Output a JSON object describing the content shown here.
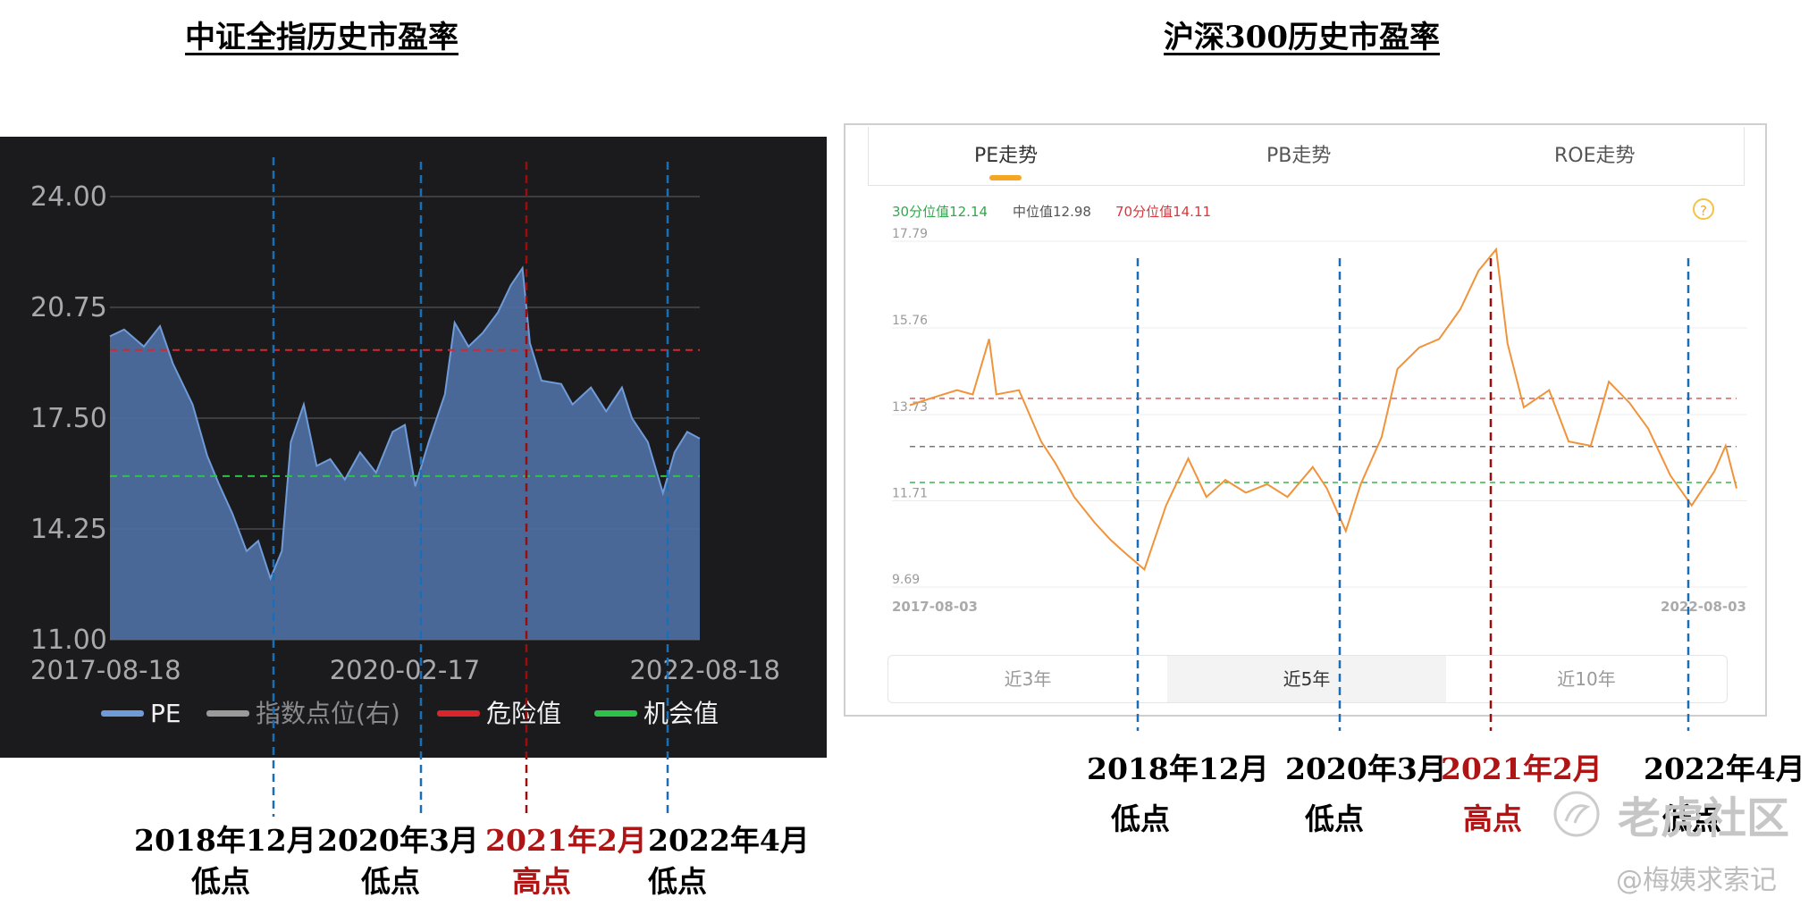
{
  "titles": {
    "left": "中证全指历史市盈率",
    "right": "沪深300历史市盈率"
  },
  "left_chart": {
    "y_ticks": [
      "24.00",
      "20.75",
      "17.50",
      "14.25",
      "11.00"
    ],
    "x_ticks": [
      "2017-08-18",
      "2020-02-17",
      "2022-08-18"
    ],
    "legend": [
      "PE",
      "指数点位(右)",
      "危险值",
      "机会值"
    ]
  },
  "right_chart": {
    "tabs": [
      "PE走势",
      "PB走势",
      "ROE走势"
    ],
    "stats": {
      "p30": "30分位值12.14",
      "median": "中位值12.98",
      "p70": "70分位值14.11"
    },
    "help": "?",
    "y_ticks": [
      "17.79",
      "15.76",
      "13.73",
      "11.71",
      "9.69"
    ],
    "x_start": "2017-08-03",
    "x_end": "2022-08-03",
    "range_buttons": [
      "近3年",
      "近5年",
      "近10年"
    ]
  },
  "left_annotations": [
    {
      "date": "2018年12月",
      "label": "低点"
    },
    {
      "date": "2020年3月",
      "label": "低点"
    },
    {
      "date": "2021年2月",
      "label": "高点"
    },
    {
      "date": "2022年4月",
      "label": "低点"
    }
  ],
  "right_annotations": [
    {
      "date": "2018年12月",
      "label": "低点"
    },
    {
      "date": "2020年3月",
      "label": "低点"
    },
    {
      "date": "2021年2月",
      "label": "高点"
    },
    {
      "date": "2022年4月",
      "label": "低点"
    }
  ],
  "watermarks": {
    "logo": "老虎社区",
    "author": "@梅姨求索记"
  },
  "colors": {
    "pe_fill": "#4d6fa3",
    "pe_line": "#6f9bd8",
    "danger": "#d9252c",
    "opportunity": "#2fc24a",
    "index": "#9a9a9a",
    "orange": "#f0933a",
    "marker_blue": "#1a6eb5",
    "marker_red": "#9b0c0c"
  },
  "chart_data": [
    {
      "type": "area",
      "series": [
        {
          "name": "PE",
          "points": [
            [
              "2017-08-18",
              19.9
            ],
            [
              "2017-10-01",
              20.1
            ],
            [
              "2017-12-01",
              19.6
            ],
            [
              "2018-01-20",
              20.2
            ],
            [
              "2018-03-01",
              19.1
            ],
            [
              "2018-05-01",
              17.9
            ],
            [
              "2018-06-15",
              16.4
            ],
            [
              "2018-07-20",
              15.6
            ],
            [
              "2018-09-01",
              14.7
            ],
            [
              "2018-10-15",
              13.6
            ],
            [
              "2018-11-20",
              13.9
            ],
            [
              "2018-12-28",
              12.8
            ],
            [
              "2019-02-01",
              13.6
            ],
            [
              "2019-03-01",
              16.8
            ],
            [
              "2019-04-10",
              17.9
            ],
            [
              "2019-05-20",
              16.1
            ],
            [
              "2019-07-01",
              16.3
            ],
            [
              "2019-08-15",
              15.7
            ],
            [
              "2019-10-01",
              16.5
            ],
            [
              "2019-11-20",
              15.9
            ],
            [
              "2020-01-10",
              17.1
            ],
            [
              "2020-02-17",
              17.3
            ],
            [
              "2020-03-20",
              15.5
            ],
            [
              "2020-05-01",
              16.8
            ],
            [
              "2020-06-20",
              18.2
            ],
            [
              "2020-07-20",
              20.3
            ],
            [
              "2020-09-01",
              19.6
            ],
            [
              "2020-10-15",
              20.0
            ],
            [
              "2020-12-01",
              20.6
            ],
            [
              "2021-01-10",
              21.4
            ],
            [
              "2021-02-15",
              21.9
            ],
            [
              "2021-03-10",
              19.7
            ],
            [
              "2021-04-15",
              18.6
            ],
            [
              "2021-06-15",
              18.5
            ],
            [
              "2021-07-20",
              17.9
            ],
            [
              "2021-09-15",
              18.4
            ],
            [
              "2021-11-01",
              17.7
            ],
            [
              "2021-12-20",
              18.4
            ],
            [
              "2022-01-20",
              17.5
            ],
            [
              "2022-03-10",
              16.8
            ],
            [
              "2022-04-26",
              15.3
            ],
            [
              "2022-06-01",
              16.5
            ],
            [
              "2022-07-10",
              17.1
            ],
            [
              "2022-08-18",
              16.9
            ]
          ]
        }
      ],
      "reference_lines": [
        {
          "name": "危险值",
          "value": 19.5
        },
        {
          "name": "机会值",
          "value": 15.8
        }
      ],
      "ylim": [
        11.0,
        24.0
      ],
      "grid": true,
      "legend_position": "bottom"
    },
    {
      "type": "line",
      "series": [
        {
          "name": "PE",
          "points": [
            [
              "2017-08-03",
              13.95
            ],
            [
              "2017-09-15",
              14.1
            ],
            [
              "2017-11-15",
              14.3
            ],
            [
              "2017-12-20",
              14.2
            ],
            [
              "2018-01-25",
              15.5
            ],
            [
              "2018-02-10",
              14.2
            ],
            [
              "2018-04-01",
              14.3
            ],
            [
              "2018-05-20",
              13.1
            ],
            [
              "2018-06-20",
              12.6
            ],
            [
              "2018-08-01",
              11.8
            ],
            [
              "2018-09-15",
              11.2
            ],
            [
              "2018-10-20",
              10.8
            ],
            [
              "2018-11-20",
              10.5
            ],
            [
              "2019-01-03",
              10.1
            ],
            [
              "2019-02-20",
              11.6
            ],
            [
              "2019-04-10",
              12.7
            ],
            [
              "2019-05-20",
              11.8
            ],
            [
              "2019-07-01",
              12.2
            ],
            [
              "2019-08-15",
              11.9
            ],
            [
              "2019-10-01",
              12.1
            ],
            [
              "2019-11-15",
              11.8
            ],
            [
              "2020-01-10",
              12.5
            ],
            [
              "2020-02-10",
              12.0
            ],
            [
              "2020-03-23",
              11.0
            ],
            [
              "2020-04-25",
              12.1
            ],
            [
              "2020-06-10",
              13.2
            ],
            [
              "2020-07-15",
              14.8
            ],
            [
              "2020-09-01",
              15.3
            ],
            [
              "2020-10-15",
              15.5
            ],
            [
              "2020-12-01",
              16.2
            ],
            [
              "2021-01-10",
              17.1
            ],
            [
              "2021-02-18",
              17.6
            ],
            [
              "2021-03-15",
              15.4
            ],
            [
              "2021-04-20",
              13.9
            ],
            [
              "2021-06-15",
              14.3
            ],
            [
              "2021-07-28",
              13.1
            ],
            [
              "2021-09-15",
              13.0
            ],
            [
              "2021-10-25",
              14.5
            ],
            [
              "2021-12-10",
              14.0
            ],
            [
              "2022-01-20",
              13.4
            ],
            [
              "2022-03-10",
              12.3
            ],
            [
              "2022-04-26",
              11.6
            ],
            [
              "2022-06-15",
              12.4
            ],
            [
              "2022-07-10",
              13.0
            ],
            [
              "2022-08-03",
              12.0
            ]
          ]
        }
      ],
      "reference_lines": [
        {
          "name": "30分位值",
          "value": 12.14
        },
        {
          "name": "中位值",
          "value": 12.98
        },
        {
          "name": "70分位值",
          "value": 14.11
        }
      ],
      "ylim": [
        9.69,
        17.79
      ],
      "grid": true
    }
  ]
}
